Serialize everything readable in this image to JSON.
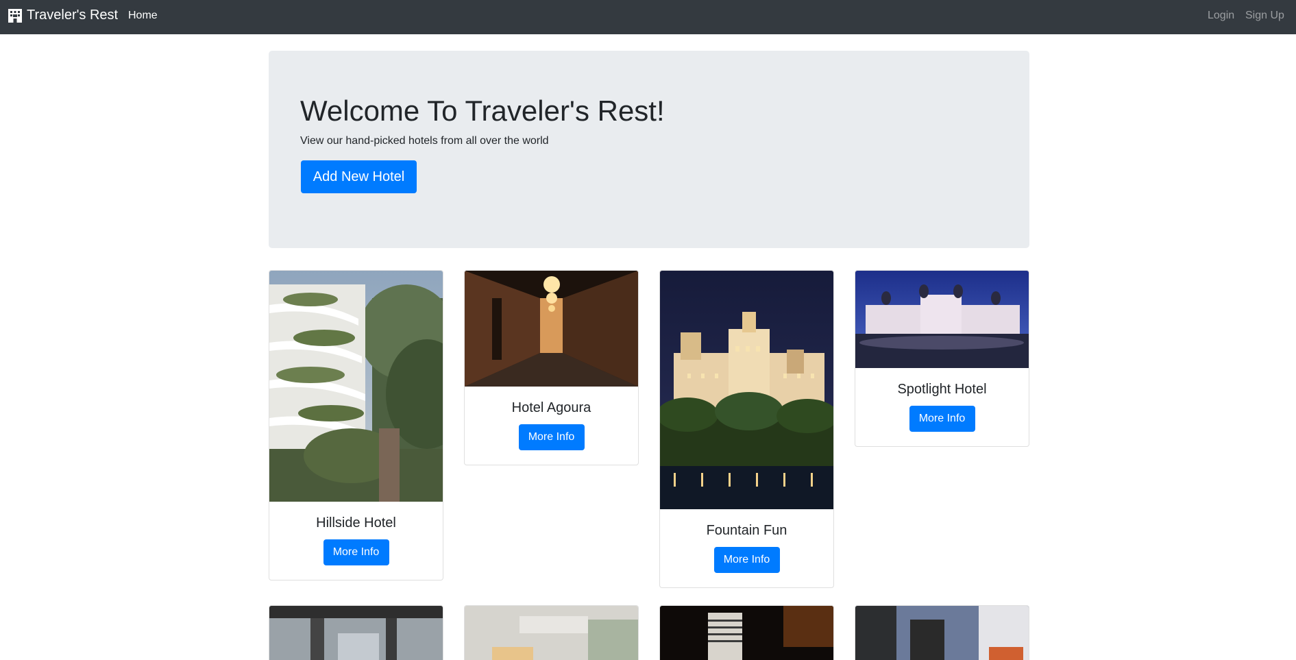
{
  "navbar": {
    "brand": "Traveler's Rest",
    "brand_icon": "hotel-building-icon",
    "links": {
      "home": "Home",
      "login": "Login",
      "signup": "Sign Up"
    }
  },
  "jumbotron": {
    "title": "Welcome To Traveler's Rest!",
    "subtitle": "View our hand-picked hotels from all over the world",
    "button": "Add New Hotel"
  },
  "hotels": [
    {
      "name": "Hillside Hotel",
      "button": "More Info"
    },
    {
      "name": "Hotel Agoura",
      "button": "More Info"
    },
    {
      "name": "Fountain Fun",
      "button": "More Info"
    },
    {
      "name": "Spotlight Hotel",
      "button": "More Info"
    }
  ],
  "colors": {
    "navbar": "#343a40",
    "primary": "#007bff",
    "jumbotron": "#e9ecef"
  }
}
